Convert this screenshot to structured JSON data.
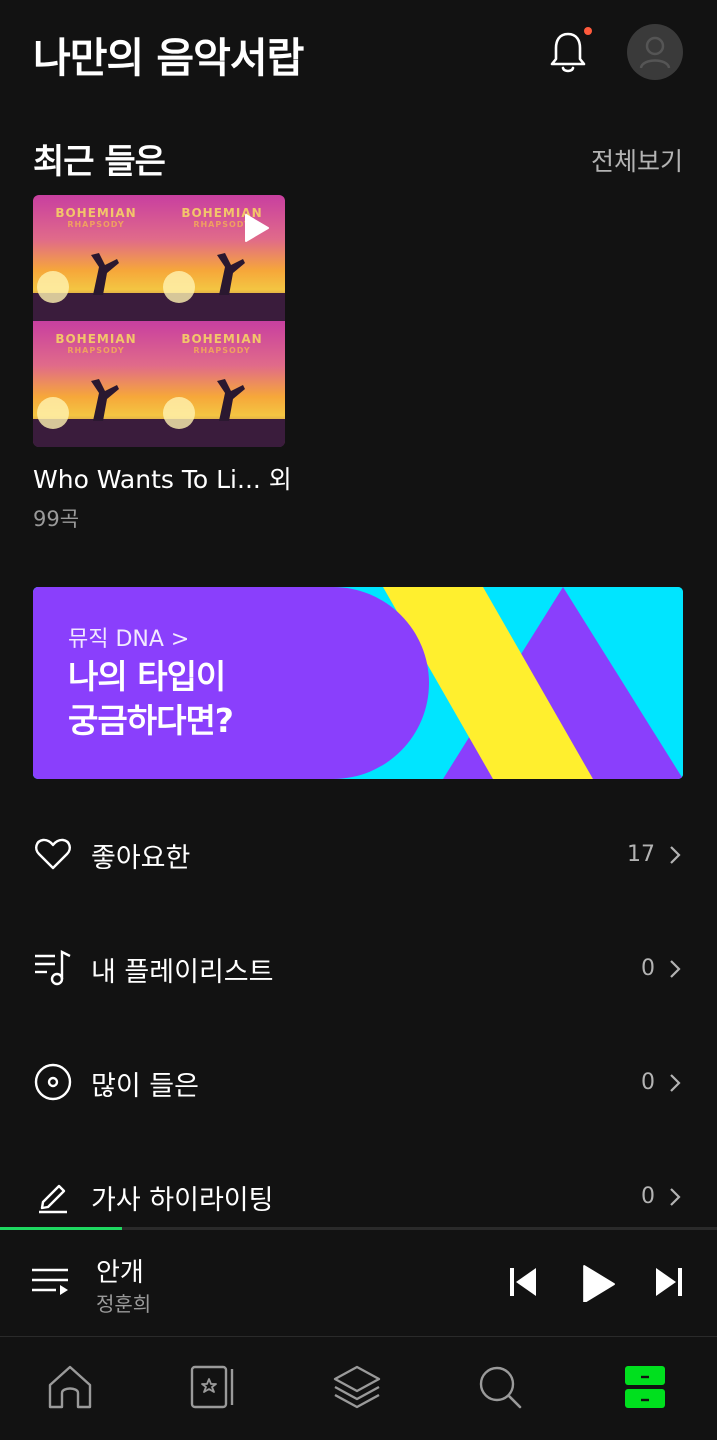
{
  "header": {
    "title": "나만의 음악서랍",
    "bell_icon": "bell-icon",
    "avatar_icon": "user-icon",
    "notification_color": "#ff5a3c"
  },
  "recent": {
    "title": "최근 들은",
    "see_all": "전체보기",
    "album": {
      "cover_text": "BOHEMIAN",
      "cover_subtext": "RHAPSODY",
      "title": "Who Wants To Li... 외",
      "count": "99곡"
    }
  },
  "banner": {
    "subtitle": "뮤직 DNA >",
    "headline_line1": "나의 타입이",
    "headline_line2": "궁금하다면?",
    "colors": {
      "purple": "#8a3ffc",
      "cyan": "#00e5ff",
      "yellow": "#ffef2e"
    }
  },
  "library": {
    "items": [
      {
        "label": "좋아요한",
        "count": "17",
        "icon": "heart-icon"
      },
      {
        "label": "내 플레이리스트",
        "count": "0",
        "icon": "playlist-icon"
      },
      {
        "label": "많이 들은",
        "count": "0",
        "icon": "disc-icon"
      },
      {
        "label": "가사 하이라이팅",
        "count": "0",
        "icon": "highlight-pen-icon"
      }
    ]
  },
  "player": {
    "title": "안개",
    "artist": "정훈희",
    "progress": 0.17,
    "accent": "#1ed760"
  },
  "tabbar": {
    "items": [
      {
        "name": "home",
        "icon": "home-icon",
        "active": false
      },
      {
        "name": "magazine",
        "icon": "star-card-icon",
        "active": false
      },
      {
        "name": "browse",
        "icon": "layers-icon",
        "active": false
      },
      {
        "name": "search",
        "icon": "search-icon",
        "active": false
      },
      {
        "name": "library",
        "icon": "drawer-icon",
        "active": true
      }
    ],
    "active_color": "#00e01e"
  }
}
